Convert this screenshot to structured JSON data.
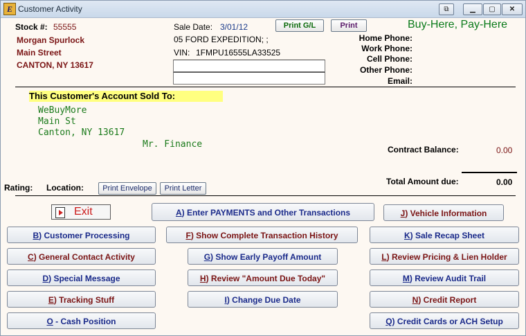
{
  "window": {
    "title": "Customer Activity",
    "app_icon_letter": "E"
  },
  "stock": {
    "label": "Stock #:",
    "number": "55555"
  },
  "customer": {
    "name": "Morgan Spurlock",
    "street": "Main Street",
    "city": "CANTON, NY 13617"
  },
  "sale": {
    "date_label": "Sale Date:",
    "date": "3/01/12",
    "vehicle": "05 FORD EXPEDITION; ;",
    "vin_label": "VIN:",
    "vin": "1FMPU16555LA33525"
  },
  "buttons_top": {
    "print_gl": "Print G/L",
    "print": "Print"
  },
  "brand": "Buy-Here, Pay-Here",
  "phones": {
    "home": "Home Phone:",
    "work": "Work Phone:",
    "cell": "Cell Phone:",
    "other": "Other Phone:",
    "email": "Email:"
  },
  "sold_to": {
    "heading": "This Customer's Account Sold To:",
    "name": "WeBuyMore",
    "street": "Main St",
    "city": "Canton, NY 13617",
    "contact": "Mr. Finance"
  },
  "contract": {
    "balance_label": "Contract Balance:",
    "balance": "0.00",
    "total_label": "Total Amount due:",
    "total": "0.00"
  },
  "rating_label": "Rating:",
  "location_label": "Location:",
  "print_envelope": "Print Envelope",
  "print_letter": "Print Letter",
  "exit": "Exit",
  "actions": {
    "a": {
      "key": "A",
      "label": ") Enter PAYMENTS and Other Transactions"
    },
    "b": {
      "key": "B",
      "label": ") Customer Processing"
    },
    "c": {
      "key": "C",
      "label": ") General Contact Activity"
    },
    "d": {
      "key": "D",
      "label": ") Special Message"
    },
    "e": {
      "key": "E",
      "label": ") Tracking Stuff"
    },
    "o": {
      "key": "O",
      "label": " - Cash Position"
    },
    "f": {
      "key": "F",
      "label": ") Show Complete Transaction History"
    },
    "g": {
      "key": "G",
      "label": ") Show Early Payoff Amount"
    },
    "h": {
      "key": "H",
      "label": ") Review \"Amount Due Today\""
    },
    "i": {
      "key": "I",
      "label": ") Change Due Date"
    },
    "j": {
      "key": "J",
      "label": ") Vehicle Information"
    },
    "k": {
      "key": "K",
      "label": ") Sale Recap Sheet"
    },
    "l": {
      "key": "L",
      "label": ") Review Pricing & Lien Holder"
    },
    "m": {
      "key": "M",
      "label": ") Review Audit Trail"
    },
    "n": {
      "key": "N",
      "label": ") Credit Report"
    },
    "q": {
      "key": "Q",
      "label": ") Credit Cards or ACH Setup"
    }
  }
}
